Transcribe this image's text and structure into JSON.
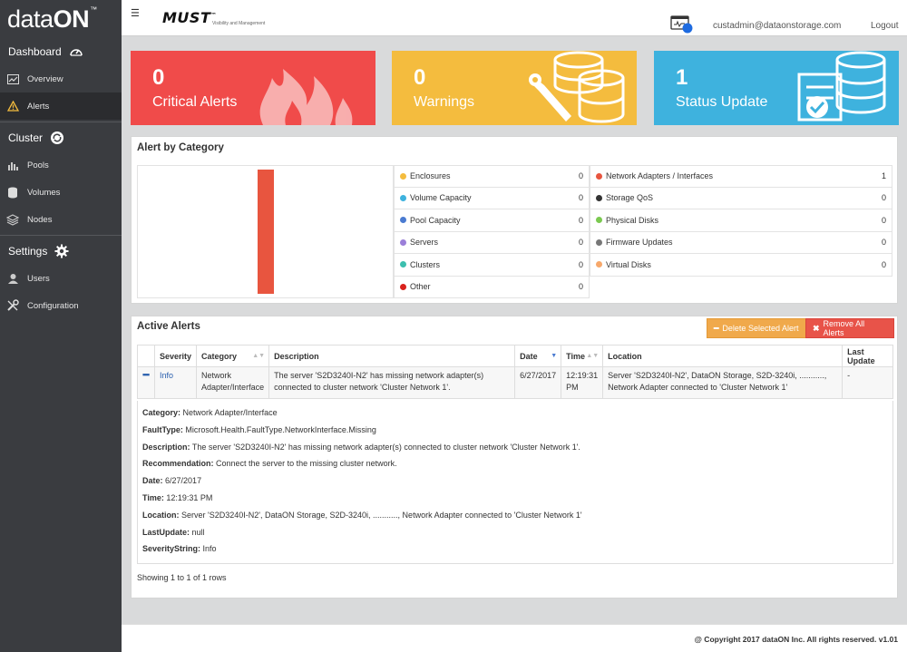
{
  "sidebar": {
    "logo_prefix": "data",
    "logo_suffix": "ON",
    "logo_mark": "™",
    "sections": [
      {
        "title": "Dashboard",
        "icon": "gauge-icon"
      },
      {
        "title": "Cluster",
        "icon": "sync-icon"
      },
      {
        "title": "Settings",
        "icon": "gear-icon"
      }
    ],
    "items": [
      {
        "label": "Overview",
        "icon": "line-chart-icon"
      },
      {
        "label": "Alerts",
        "icon": "warning-icon",
        "active": true
      },
      {
        "label": "Pools",
        "icon": "bar-chart-icon"
      },
      {
        "label": "Volumes",
        "icon": "database-icon"
      },
      {
        "label": "Nodes",
        "icon": "cubes-icon"
      },
      {
        "label": "Users",
        "icon": "user-icon"
      },
      {
        "label": "Configuration",
        "icon": "wrench-icon"
      }
    ]
  },
  "header": {
    "menu_icon": "☰",
    "brand": "MUST",
    "brand_mark": "™",
    "brand_tagline": "Visibility and Management",
    "user_email": "custadmin@dataonstorage.com",
    "logout": "Logout"
  },
  "tiles": [
    {
      "count": "0",
      "label": "Critical Alerts",
      "color": "#f04b4a"
    },
    {
      "count": "0",
      "label": "Warnings",
      "color": "#f4bc3e"
    },
    {
      "count": "1",
      "label": "Status Update",
      "color": "#3eb2de"
    }
  ],
  "category_panel": {
    "title": "Alert by Category",
    "left_column": [
      {
        "name": "Enclosures",
        "count": "0",
        "color": "#f4bc3e"
      },
      {
        "name": "Volume Capacity",
        "count": "0",
        "color": "#3eb2de"
      },
      {
        "name": "Pool Capacity",
        "count": "0",
        "color": "#4a7bd1"
      },
      {
        "name": "Servers",
        "count": "0",
        "color": "#9b7fd9"
      },
      {
        "name": "Clusters",
        "count": "0",
        "color": "#3cbfae"
      },
      {
        "name": "Other",
        "count": "0",
        "color": "#d9221c"
      }
    ],
    "right_column": [
      {
        "name": "Network Adapters / Interfaces",
        "count": "1",
        "color": "#e8553f"
      },
      {
        "name": "Storage QoS",
        "count": "0",
        "color": "#333333"
      },
      {
        "name": "Physical Disks",
        "count": "0",
        "color": "#7bc950"
      },
      {
        "name": "Firmware Updates",
        "count": "0",
        "color": "#777777"
      },
      {
        "name": "Virtual Disks",
        "count": "0",
        "color": "#f7a86b"
      }
    ]
  },
  "chart_data": {
    "type": "bar",
    "categories": [
      "Network Adapters / Interfaces"
    ],
    "values": [
      1
    ],
    "colors": [
      "#e8553f"
    ],
    "ylim": [
      0,
      1
    ],
    "title": "",
    "xlabel": "",
    "ylabel": "",
    "grid": false
  },
  "alerts_panel": {
    "title": "Active Alerts",
    "delete_button": "Delete Selected Alert",
    "remove_button": "Remove All Alerts",
    "columns": [
      "Severity",
      "Category",
      "Description",
      "Date",
      "Time",
      "Location",
      "Last Update"
    ],
    "rows": [
      {
        "severity": "Info",
        "category": "Network Adapter/Interface",
        "description": "The server 'S2D3240I-N2' has missing network adapter(s) connected to cluster network 'Cluster Network 1'.",
        "date": "6/27/2017",
        "time": "12:19:31 PM",
        "location": "Server 'S2D3240I-N2', DataON Storage, S2D-3240i, ..........., Network Adapter connected to 'Cluster Network 1'",
        "last_update": "-"
      }
    ],
    "detail": [
      {
        "label": "Category:",
        "value": "Network Adapter/Interface"
      },
      {
        "label": "FaultType:",
        "value": "Microsoft.Health.FaultType.NetworkInterface.Missing"
      },
      {
        "label": "Description:",
        "value": "The server 'S2D3240I-N2' has missing network adapter(s) connected to cluster network 'Cluster Network 1'."
      },
      {
        "label": "Recommendation:",
        "value": "Connect the server to the missing cluster network."
      },
      {
        "label": "Date:",
        "value": "6/27/2017"
      },
      {
        "label": "Time:",
        "value": "12:19:31 PM"
      },
      {
        "label": "Location:",
        "value": "Server 'S2D3240I-N2', DataON Storage, S2D-3240i, ..........., Network Adapter connected to 'Cluster Network 1'"
      },
      {
        "label": "LastUpdate:",
        "value": "null"
      },
      {
        "label": "SeverityString:",
        "value": "Info"
      }
    ],
    "showing": "Showing 1 to 1 of 1 rows"
  },
  "footer": {
    "copyright": "@ Copyright 2017 dataON Inc. All rights reserved. v1.01"
  }
}
